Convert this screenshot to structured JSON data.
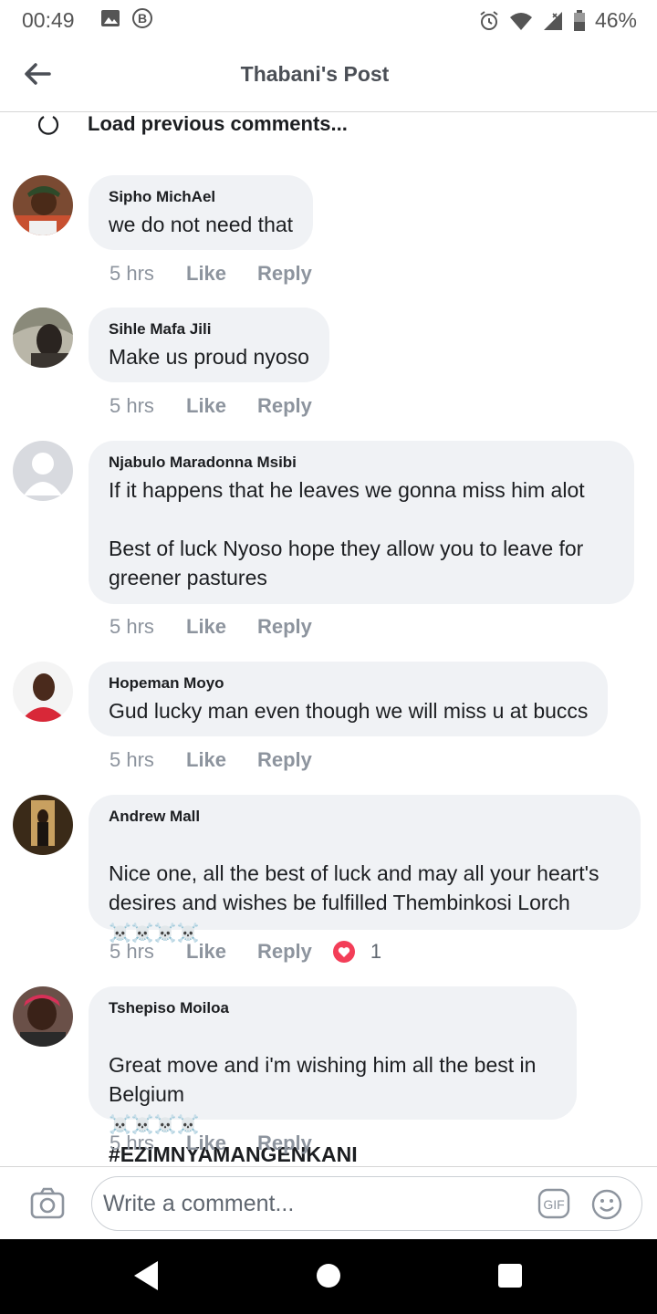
{
  "status_bar": {
    "time": "00:49",
    "battery": "46%"
  },
  "header": {
    "title": "Thabani's Post"
  },
  "load_previous": "Load previous comments...",
  "comments": [
    {
      "author": "Sipho MichAel",
      "text": "we do not need that",
      "time": "5 hrs",
      "like": "Like",
      "reply": "Reply"
    },
    {
      "author": "Sihle Mafa Jili",
      "text": "Make us proud nyoso",
      "time": "5 hrs",
      "like": "Like",
      "reply": "Reply"
    },
    {
      "author": "Njabulo Maradonna Msibi",
      "text": "If it happens that he leaves we gonna miss him alot\n\nBest of luck Nyoso hope they allow you to leave for greener pastures",
      "time": "5 hrs",
      "like": "Like",
      "reply": "Reply"
    },
    {
      "author": "Hopeman Moyo",
      "text": "Gud lucky man even though we will miss u at buccs",
      "time": "5 hrs",
      "like": "Like",
      "reply": "Reply"
    },
    {
      "author": "Andrew Mall",
      "text": "Nice one, all the best of luck and may all your heart's desires and wishes be fulfilled Thembinkosi Lorch",
      "emoji": "☠️☠️☠️☠️",
      "time": "5 hrs",
      "like": "Like",
      "reply": "Reply",
      "reaction_count": "1"
    },
    {
      "author": "Tshepiso Moiloa",
      "text": "Great move and i'm wishing him all the best in Belgium",
      "emoji": "☠️☠️☠️☠️",
      "hashtag": "#EZIMNYAMANGENKANI",
      "time": "5 hrs",
      "like": "Like",
      "reply": "Reply"
    }
  ],
  "comment_bar": {
    "placeholder": "Write a comment..."
  }
}
